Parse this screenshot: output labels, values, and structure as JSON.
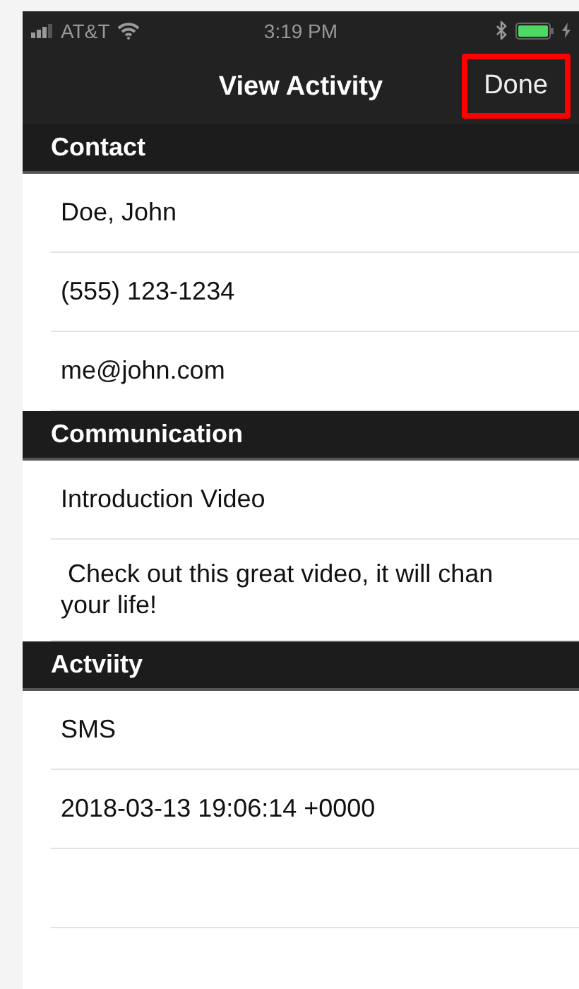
{
  "status_bar": {
    "carrier": "AT&T",
    "time": "3:19 PM",
    "charging": true
  },
  "nav_bar": {
    "title": "View Activity",
    "done_button": {
      "label": "Done",
      "highlighted": true
    }
  },
  "sections": [
    {
      "title": "Contact",
      "rows": [
        {
          "text": "Doe, John"
        },
        {
          "text": "(555) 123-1234"
        },
        {
          "text": "me@john.com"
        }
      ]
    },
    {
      "title": "Communication",
      "rows": [
        {
          "text": "Introduction Video"
        },
        {
          "text": " Check out this great video, it will chan\nyour life!"
        }
      ]
    },
    {
      "title": "Actviity",
      "rows": [
        {
          "text": "SMS"
        },
        {
          "text": "2018-03-13 19:06:14 +0000"
        },
        {
          "text": null
        }
      ]
    }
  ]
}
